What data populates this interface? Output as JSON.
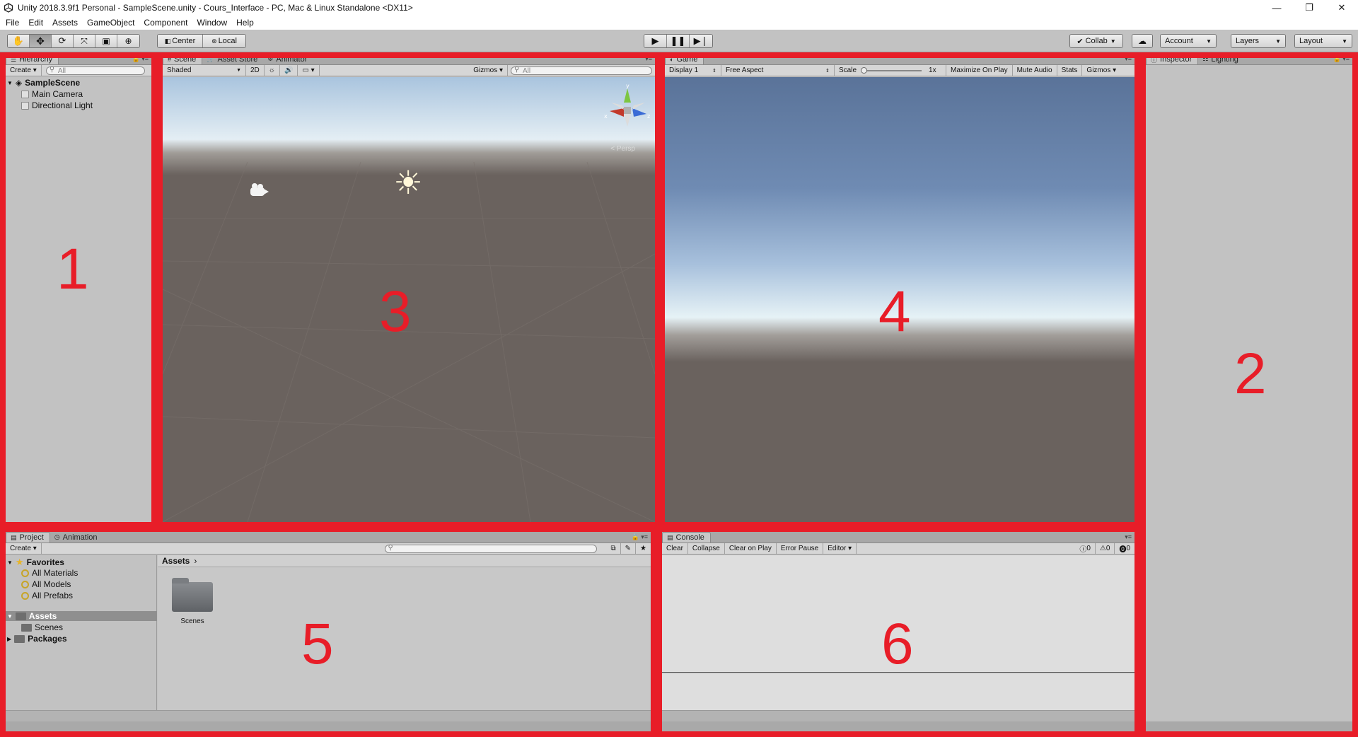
{
  "window": {
    "title": "Unity 2018.3.9f1 Personal - SampleScene.unity - Cours_Interface - PC, Mac & Linux Standalone <DX11>",
    "minimize": "—",
    "restore": "❐",
    "close": "✕"
  },
  "menu": [
    "File",
    "Edit",
    "Assets",
    "GameObject",
    "Component",
    "Window",
    "Help"
  ],
  "toolbar": {
    "center": "Center",
    "local": "Local",
    "collab": "Collab",
    "account": "Account",
    "layers": "Layers",
    "layout": "Layout"
  },
  "hierarchy": {
    "tab": "Hierarchy",
    "create": "Create",
    "search_placeholder": "All",
    "scene": "SampleScene",
    "items": [
      "Main Camera",
      "Directional Light"
    ]
  },
  "scene": {
    "tabs": [
      "Scene",
      "Asset Store",
      "Animator"
    ],
    "shading": "Shaded",
    "mode_2d": "2D",
    "gizmos": "Gizmos",
    "search_placeholder": "All",
    "axis_y": "y",
    "axis_x": "x",
    "axis_z": "z",
    "persp": "< Persp"
  },
  "game": {
    "tab": "Game",
    "display": "Display 1",
    "aspect": "Free Aspect",
    "scale_label": "Scale",
    "scale_value": "1x",
    "maximize": "Maximize On Play",
    "mute": "Mute Audio",
    "stats": "Stats",
    "gizmos": "Gizmos"
  },
  "inspector": {
    "tabs": [
      "Inspector",
      "Lighting"
    ]
  },
  "project": {
    "tabs": [
      "Project",
      "Animation"
    ],
    "create": "Create",
    "favorites": "Favorites",
    "favorite_items": [
      "All Materials",
      "All Models",
      "All Prefabs"
    ],
    "assets": "Assets",
    "asset_children": [
      "Scenes"
    ],
    "packages": "Packages",
    "breadcrumb": "Assets",
    "folder_label": "Scenes"
  },
  "console": {
    "tab": "Console",
    "buttons": [
      "Clear",
      "Collapse",
      "Clear on Play",
      "Error Pause",
      "Editor"
    ],
    "info_count": "0",
    "warn_count": "0",
    "error_count": "0"
  },
  "annotations": [
    "1",
    "2",
    "3",
    "4",
    "5",
    "6"
  ],
  "colors": {
    "annotation_red": "#e81d28",
    "panel_gray": "#c2c2c2",
    "scene_ground": "#6a625e",
    "game_sky": "#5a7399"
  }
}
